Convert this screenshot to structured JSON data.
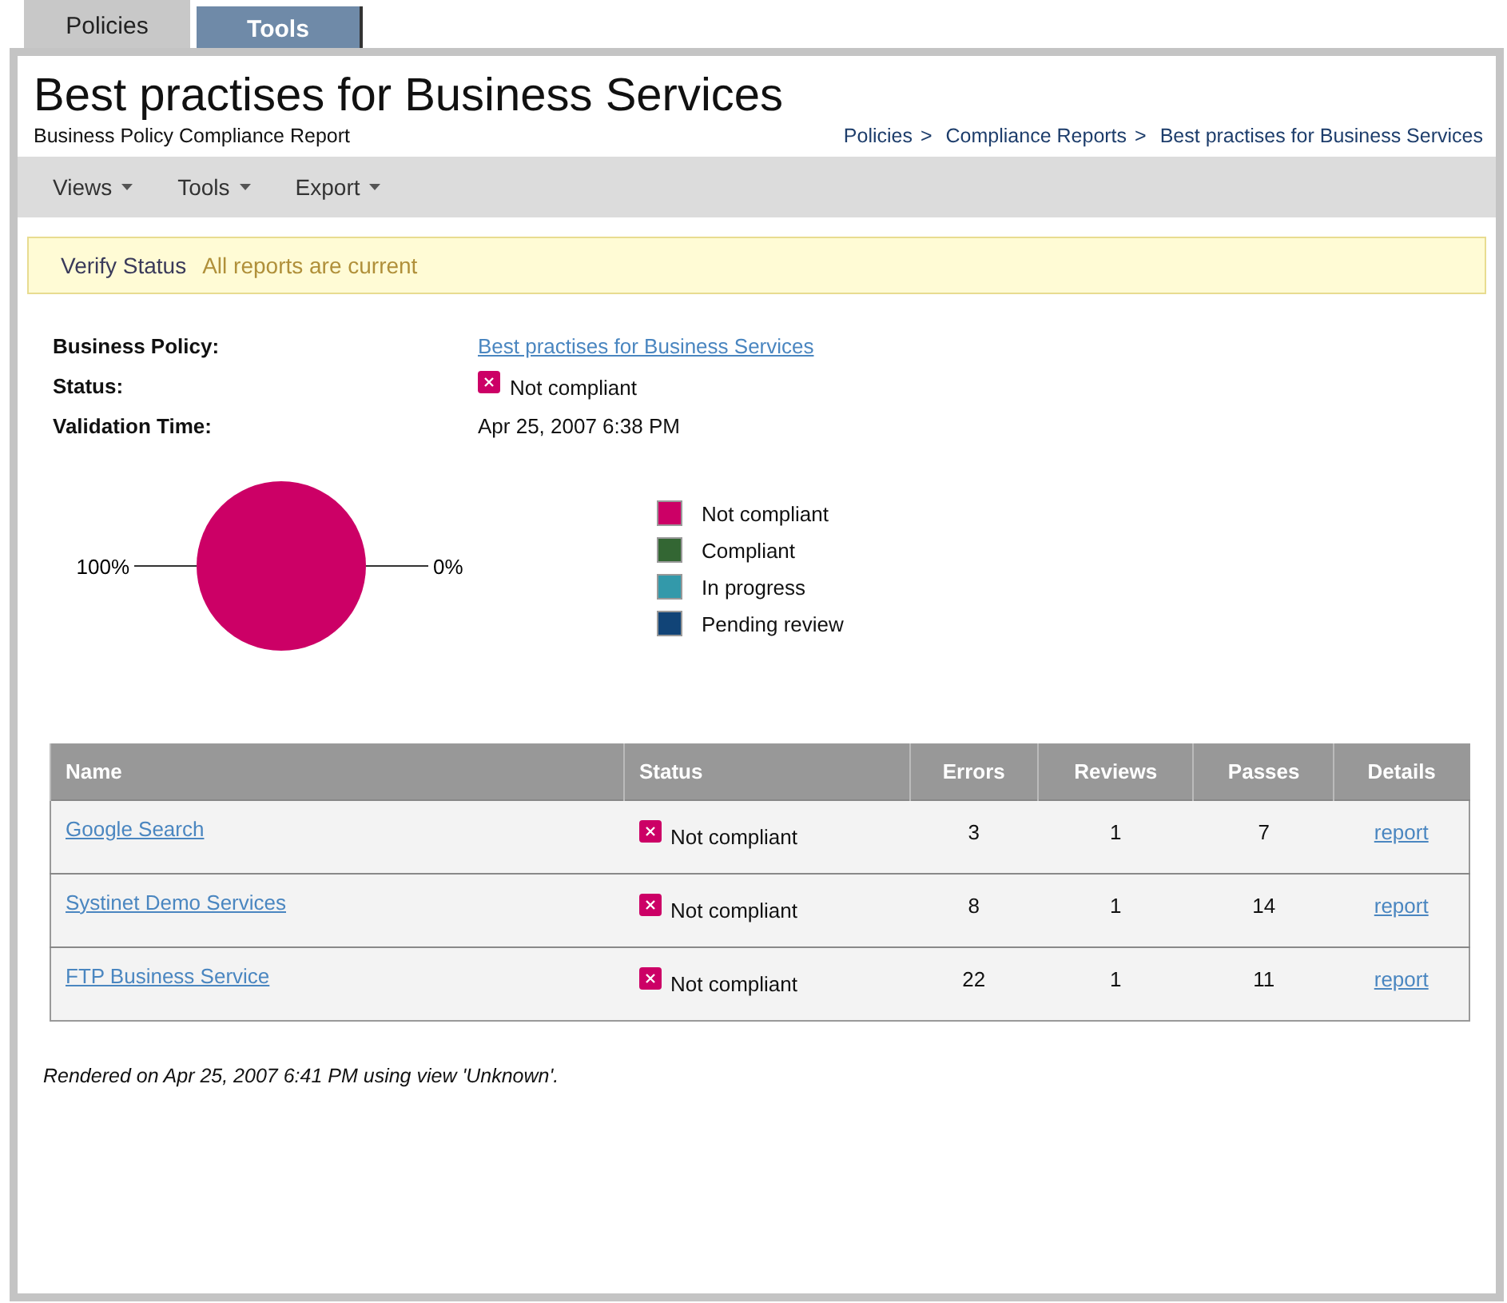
{
  "tabs": [
    {
      "label": "Policies",
      "selected": true
    },
    {
      "label": "Tools",
      "selected": false
    }
  ],
  "header": {
    "title": "Best practises for Business Services",
    "subtitle": "Business Policy Compliance Report",
    "breadcrumb": [
      "Policies",
      "Compliance Reports",
      "Best practises for Business Services"
    ],
    "separator": ">"
  },
  "menu": [
    {
      "label": "Views"
    },
    {
      "label": "Tools"
    },
    {
      "label": "Export"
    }
  ],
  "notice": {
    "label": "Verify Status",
    "message": "All reports are current"
  },
  "details": [
    {
      "label": "Business Policy:",
      "kind": "link",
      "value": "Best practises for Business Services"
    },
    {
      "label": "Status:",
      "kind": "status",
      "value": "Not compliant",
      "compliant": false
    },
    {
      "label": "Validation Time:",
      "kind": "text",
      "value": "Apr 25, 2007 6:38 PM"
    }
  ],
  "chart_data": {
    "type": "pie",
    "categories": [
      "Not compliant",
      "Compliant",
      "In progress",
      "Pending review"
    ],
    "values": [
      100,
      0,
      0,
      0
    ]
  },
  "slice_labels": [
    "100%",
    "0%"
  ],
  "legend": [
    {
      "color": "#cc0066"
    },
    {
      "color": "#336633"
    },
    {
      "color": "#3399aa"
    },
    {
      "color": "#114477"
    }
  ],
  "table": {
    "columns": [
      "Name",
      "Status",
      "Errors",
      "Reviews",
      "Passes",
      "Details"
    ],
    "rows": [
      {
        "name": "Google Search",
        "status": "Not compliant",
        "compliant": false,
        "errors": "3",
        "reviews": "1",
        "passes": "7",
        "details": "report"
      },
      {
        "name": "Systinet Demo Services",
        "status": "Not compliant",
        "compliant": false,
        "errors": "8",
        "reviews": "1",
        "passes": "14",
        "details": "report"
      },
      {
        "name": "FTP Business Service",
        "status": "Not compliant",
        "compliant": false,
        "errors": "22",
        "reviews": "1",
        "passes": "11",
        "details": "report"
      }
    ]
  },
  "footer": "Rendered on Apr 25, 2007 6:41 PM using view 'Unknown'."
}
